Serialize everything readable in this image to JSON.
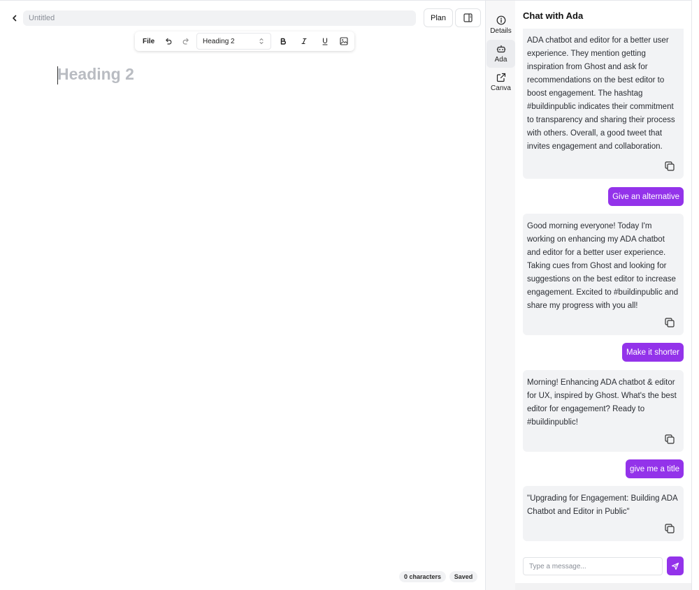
{
  "editor": {
    "title_placeholder": "Untitled",
    "plan_label": "Plan",
    "toolbar": {
      "file_label": "File",
      "block_type": "Heading 2"
    },
    "heading_placeholder": "Heading 2",
    "status": {
      "characters": "0 characters",
      "saved": "Saved"
    }
  },
  "rail": {
    "items": [
      {
        "label": "Details",
        "icon": "info-icon"
      },
      {
        "label": "Ada",
        "icon": "bot-icon",
        "active": true
      },
      {
        "label": "Canva",
        "icon": "external-link-icon"
      }
    ]
  },
  "chat": {
    "title": "Chat with Ada",
    "messages": [
      {
        "role": "assistant",
        "text": "ADA chatbot and editor for a better user experience. They mention getting inspiration from Ghost and ask for recommendations on the best editor to boost engagement. The hashtag #buildinpublic indicates their commitment to transparency and sharing their process with others. Overall, a good tweet that invites engagement and collaboration."
      },
      {
        "role": "user",
        "text": "Give an alternative"
      },
      {
        "role": "assistant",
        "text": "Good morning everyone! Today I'm working on enhancing my ADA chatbot and editor for a better user experience. Taking cues from Ghost and looking for suggestions on the best editor to increase engagement. Excited to #buildinpublic and share my progress with you all!"
      },
      {
        "role": "user",
        "text": "Make it shorter"
      },
      {
        "role": "assistant",
        "text": "Morning! Enhancing ADA chatbot & editor for UX, inspired by Ghost. What's the best editor for engagement? Ready to #buildinpublic!"
      },
      {
        "role": "user",
        "text": "give me a title"
      },
      {
        "role": "assistant",
        "text": "\"Upgrading for Engagement: Building ADA Chatbot and Editor in Public\""
      }
    ],
    "input_placeholder": "Type a message...",
    "accent_color": "#9333ea"
  }
}
